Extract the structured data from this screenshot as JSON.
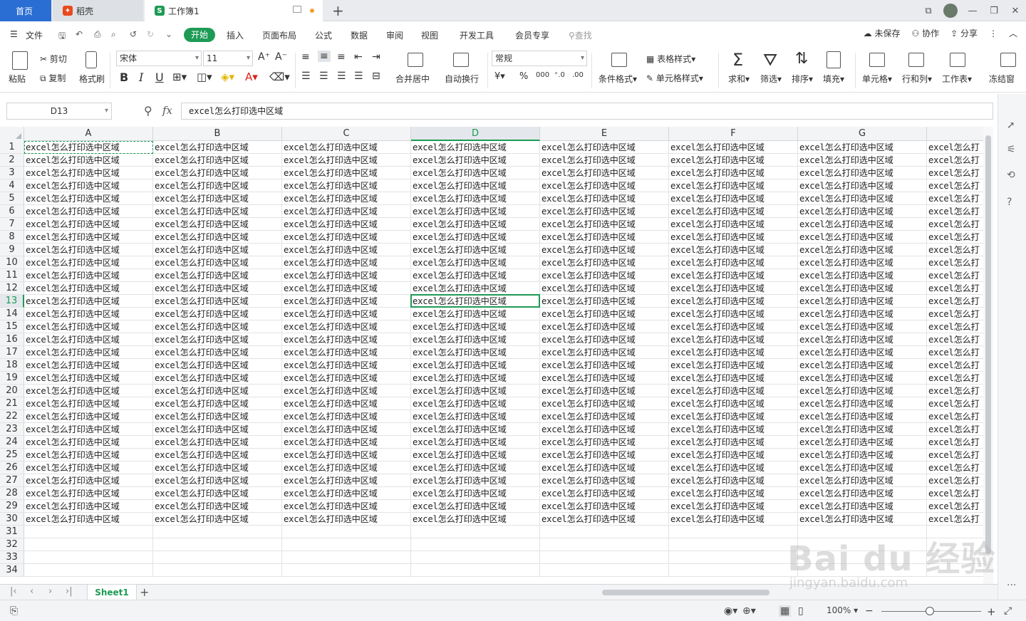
{
  "tabs": {
    "home": "首页",
    "daoke": "稻壳",
    "workbook": "工作簿1"
  },
  "menu": {
    "file": "文件",
    "start": "开始",
    "items": [
      "插入",
      "页面布局",
      "公式",
      "数据",
      "审阅",
      "视图",
      "开发工具",
      "会员专享"
    ],
    "search": "查找",
    "unsaved": "未保存",
    "collab": "协作",
    "share": "分享"
  },
  "ribbon": {
    "paste": "粘贴",
    "cut": "剪切",
    "copy": "复制",
    "format_painter": "格式刷",
    "font_name": "宋体",
    "font_size": "11",
    "merge_center": "合并居中",
    "wrap": "自动换行",
    "number_format": "常规",
    "cond_format": "条件格式",
    "table_style": "表格样式",
    "cell_style": "单元格样式",
    "sum": "求和",
    "filter": "筛选",
    "sort": "排序",
    "fill": "填充",
    "cell": "单元格",
    "row_col": "行和列",
    "worksheet": "工作表",
    "freeze": "冻结窗"
  },
  "formula_bar": {
    "name_box": "D13",
    "fx": "fx",
    "content": "excel怎么打印选中区域"
  },
  "grid": {
    "columns": [
      "A",
      "B",
      "C",
      "D",
      "E",
      "F",
      "G"
    ],
    "row_count_shown": 34,
    "filled_rows": 30,
    "cell_text": "excel怎么打印选中区域",
    "partial_column_text": "excel怎么打",
    "selected_cell": "D13",
    "copy_marquee_cell": "A1"
  },
  "sheets": {
    "active": "Sheet1"
  },
  "status": {
    "zoom": "100%"
  },
  "watermark": {
    "main": "Bai du 经验",
    "sub": "jingyan.baidu.com"
  }
}
